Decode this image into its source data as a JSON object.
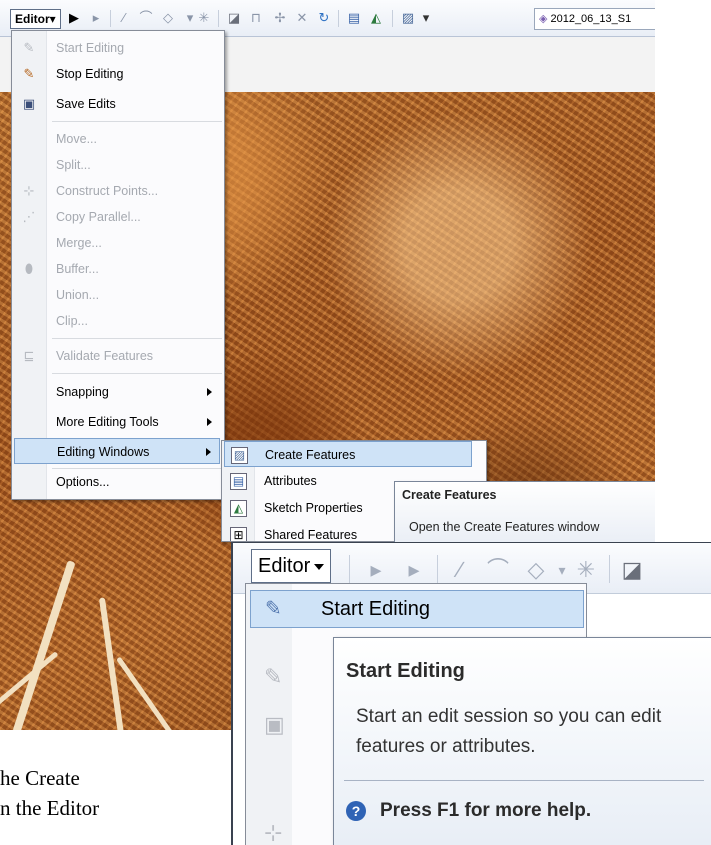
{
  "toolbar": {
    "editor_label": "Editor▾",
    "layer_name": "2012_06_13_S1"
  },
  "editor_menu": {
    "items": [
      {
        "label": "Start Editing",
        "icon": "pencil-icon",
        "enabled": false
      },
      {
        "label": "Stop Editing",
        "icon": "stop-editing-icon",
        "enabled": true
      },
      {
        "label": "Save Edits",
        "icon": "save-icon",
        "enabled": true
      },
      {
        "label": "Move...",
        "enabled": false
      },
      {
        "label": "Split...",
        "enabled": false
      },
      {
        "label": "Construct Points...",
        "icon": "construct-points-icon",
        "enabled": false
      },
      {
        "label": "Copy Parallel...",
        "icon": "copy-parallel-icon",
        "enabled": false
      },
      {
        "label": "Merge...",
        "enabled": false
      },
      {
        "label": "Buffer...",
        "icon": "buffer-icon",
        "enabled": false
      },
      {
        "label": "Union...",
        "enabled": false
      },
      {
        "label": "Clip...",
        "enabled": false
      },
      {
        "label": "Validate Features",
        "icon": "validate-icon",
        "enabled": false
      },
      {
        "label": "Snapping",
        "submenu": true,
        "enabled": true
      },
      {
        "label": "More Editing Tools",
        "submenu": true,
        "enabled": true
      },
      {
        "label": "Editing Windows",
        "submenu": true,
        "enabled": true,
        "highlighted": true
      },
      {
        "label": "Options...",
        "enabled": true
      }
    ]
  },
  "editing_windows_submenu": {
    "items": [
      {
        "label": "Create Features",
        "icon": "create-features-icon",
        "highlighted": true
      },
      {
        "label": "Attributes",
        "icon": "attributes-icon"
      },
      {
        "label": "Sketch Properties",
        "icon": "sketch-properties-icon"
      },
      {
        "label": "Shared Features",
        "icon": "shared-features-icon"
      }
    ]
  },
  "create_features_tooltip": {
    "title": "Create Features",
    "body": "Open the Create Features window"
  },
  "inset": {
    "editor_label": "Editor",
    "start_editing_label": "Start Editing",
    "tooltip": {
      "title": "Start Editing",
      "body": "Start an edit session so you can edit features or attributes.",
      "help": "Press F1 for more help."
    }
  },
  "caption": {
    "line1": "he Create",
    "line2": "n the Editor"
  }
}
